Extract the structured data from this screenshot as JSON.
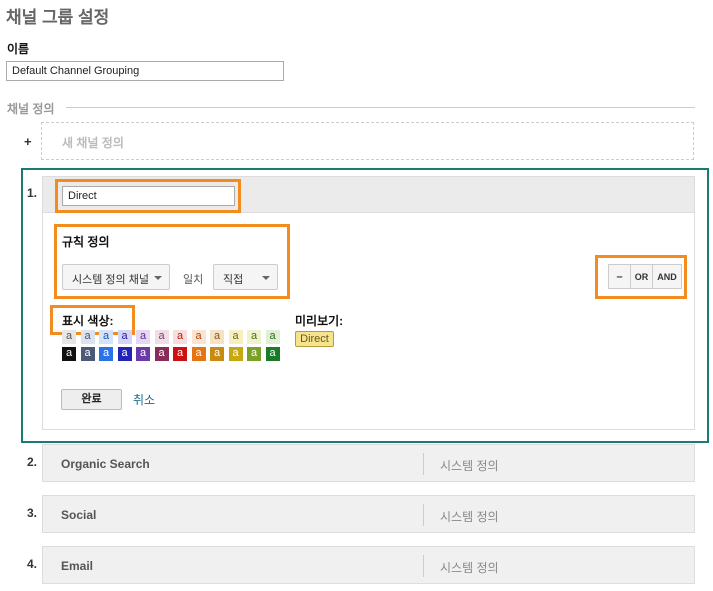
{
  "header": {
    "title": "채널 그룹 설정"
  },
  "name": {
    "label": "이름",
    "value": "Default Channel Grouping"
  },
  "channels_section": {
    "title": "채널 정의",
    "add_symbol": "+",
    "new_channel_label": "새 채널 정의"
  },
  "active_channel": {
    "number": "1.",
    "name_value": "Direct",
    "rule": {
      "title": "규칙 정의",
      "dimension": "시스템 정의 채널",
      "operator": "일치",
      "value": "직접",
      "buttons": {
        "minus": "–",
        "or": "OR",
        "and": "AND"
      }
    },
    "display_color": {
      "title": "표시 색상:",
      "swatch_letter": "a",
      "light_row": [
        {
          "bg": "#e6e6e6",
          "fg": "#555555"
        },
        {
          "bg": "#dde3ee",
          "fg": "#445577"
        },
        {
          "bg": "#d3e3fb",
          "fg": "#2255aa"
        },
        {
          "bg": "#d3d6f6",
          "fg": "#222299"
        },
        {
          "bg": "#e6d8f4",
          "fg": "#553388"
        },
        {
          "bg": "#f0dde8",
          "fg": "#774466"
        },
        {
          "bg": "#fbdcdc",
          "fg": "#aa2222"
        },
        {
          "bg": "#fbe3d3",
          "fg": "#aa4411"
        },
        {
          "bg": "#f6e3c6",
          "fg": "#885511"
        },
        {
          "bg": "#f6efc4",
          "fg": "#776611"
        },
        {
          "bg": "#eef3cf",
          "fg": "#556611"
        },
        {
          "bg": "#dff0d4",
          "fg": "#336622"
        }
      ],
      "dark_row": [
        {
          "bg": "#111111",
          "fg": "#ffffff"
        },
        {
          "bg": "#4a5a78",
          "fg": "#ffffff"
        },
        {
          "bg": "#2a72e8",
          "fg": "#ffffff"
        },
        {
          "bg": "#2323b8",
          "fg": "#ffffff"
        },
        {
          "bg": "#6a3aa8",
          "fg": "#ffffff"
        },
        {
          "bg": "#8a2a58",
          "fg": "#ffffff"
        },
        {
          "bg": "#cc1111",
          "fg": "#ffffff"
        },
        {
          "bg": "#e87311",
          "fg": "#ffffff"
        },
        {
          "bg": "#c98a11",
          "fg": "#ffffff"
        },
        {
          "bg": "#c6a811",
          "fg": "#ffffff"
        },
        {
          "bg": "#7aa028",
          "fg": "#ffffff"
        },
        {
          "bg": "#1a7a2a",
          "fg": "#ffffff"
        }
      ]
    },
    "preview": {
      "title": "미리보기:",
      "badge": "Direct"
    },
    "done_label": "완료",
    "cancel_label": "취소"
  },
  "channels": [
    {
      "number": "2.",
      "name": "Organic Search",
      "type": "시스템 정의"
    },
    {
      "number": "3.",
      "name": "Social",
      "type": "시스템 정의"
    },
    {
      "number": "4.",
      "name": "Email",
      "type": "시스템 정의"
    }
  ],
  "colors": {
    "highlight": "#f28c1f",
    "frame": "#1a7a74",
    "link": "#1c6b8c"
  }
}
